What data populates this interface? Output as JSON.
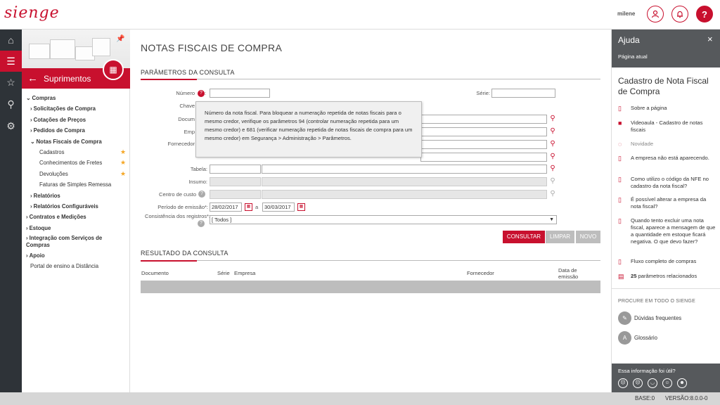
{
  "app": {
    "logo": "sienge",
    "username": "milene"
  },
  "topbar": {
    "user_icon": "user-icon",
    "bell_icon": "bell-icon",
    "help_label": "?"
  },
  "rail": [
    "home-icon",
    "menu-icon",
    "star-icon",
    "search-icon",
    "settings-icon"
  ],
  "sidebar": {
    "title": "Suprimentos",
    "menu": [
      {
        "label": "Compras",
        "level": "l1",
        "prefix": "⌄"
      },
      {
        "label": "Solicitações de Compra",
        "level": "l2",
        "prefix": "›"
      },
      {
        "label": "Cotações de Preços",
        "level": "l2",
        "prefix": "›"
      },
      {
        "label": "Pedidos de Compra",
        "level": "l2",
        "prefix": "›"
      },
      {
        "label": "Notas Fiscais de Compra",
        "level": "l2",
        "prefix": "⌄"
      },
      {
        "label": "Cadastros",
        "level": "l3",
        "star": true
      },
      {
        "label": "Conhecimentos de Fretes",
        "level": "l3",
        "star": true
      },
      {
        "label": "Devoluções",
        "level": "l3",
        "star": true
      },
      {
        "label": "Faturas de Simples Remessa",
        "level": "l3"
      },
      {
        "label": "Relatórios",
        "level": "l2",
        "prefix": "›"
      },
      {
        "label": "Relatórios Configuráveis",
        "level": "l2",
        "prefix": "›"
      },
      {
        "label": "Contratos e Medições",
        "level": "l1",
        "prefix": "›"
      },
      {
        "label": "Estoque",
        "level": "l1",
        "prefix": "›"
      },
      {
        "label": "Integração com Serviços de Compras",
        "level": "l1",
        "prefix": "›",
        "two": true
      },
      {
        "label": "Apoio",
        "level": "l1",
        "prefix": "›"
      },
      {
        "label": "Portal de ensino a Distância",
        "level": "plain"
      }
    ]
  },
  "main": {
    "page_title": "NOTAS FISCAIS DE COMPRA",
    "params_title": "PARÂMETROS DA CONSULTA",
    "results_title": "RESULTADO DA CONSULTA",
    "labels": {
      "numero": "Número",
      "serie": "Série:",
      "chave": "Chave",
      "documento": "Docum",
      "empresa": "Emp",
      "fornecedor": "Fornecedor",
      "tabela": "Tabela:",
      "insumo": "Insumo:",
      "centro_custo": "Centro de custo",
      "periodo": "Período de emissão*:",
      "periodo_sep": "a",
      "consistencia": "Consistência dos registros*:"
    },
    "colon": ":",
    "date_from": "28/02/2017",
    "date_to": "30/03/2017",
    "consistencia_value": "[ Todos ]",
    "tooltip": "Número da nota fiscal. Para bloquear a numeração repetida de notas fiscais para o mesmo credor, verifique os parâmetros 94 (controlar numeração repetida para um mesmo credor) e 681 (verificar numeração repetida de notas fiscais de compra para um mesmo credor) em Segurança > Administração > Parâmetros.",
    "buttons": {
      "consultar": "CONSULTAR",
      "limpar": "LIMPAR",
      "novo": "NOVO"
    },
    "columns": {
      "documento": "Documento",
      "serie": "Série",
      "empresa": "Empresa",
      "fornecedor": "Fornecedor",
      "data": "Data de emissão"
    }
  },
  "help": {
    "title": "Ajuda",
    "close": "×",
    "subtitle": "Página atual",
    "heading": "Cadastro de Nota Fiscal de Compra",
    "items": [
      {
        "label": "Sobre a página",
        "icon": "document-icon"
      },
      {
        "label": "Videoaula - Cadastro de notas fiscais",
        "icon": "video-icon"
      },
      {
        "label": "Novidade",
        "icon": "novelty-icon",
        "muted": true
      },
      {
        "label": "A empresa não está aparecendo.",
        "icon": "document-icon"
      },
      {
        "label": "Como utilizo o código da NFE no cadastro da nota fiscal?",
        "icon": "document-icon"
      },
      {
        "label": "É possível alterar a empresa da nota fiscal?",
        "icon": "document-icon"
      },
      {
        "label": "Quando tento excluir uma nota fiscal, aparece a mensagem de que a quantidade em estoque ficará negativa. O que devo fazer?",
        "icon": "document-icon"
      },
      {
        "label": "Fluxo completo de compras",
        "icon": "document-icon"
      }
    ],
    "params_count": "25",
    "params_label": "parâmetros relacionados",
    "search_all": "PROCURE EM TODO O SIENGE",
    "faq": "Dúvidas frequentes",
    "glossary": "Glossário",
    "feedback_q": "Essa informação foi útil?"
  },
  "status": {
    "base": "BASE:0",
    "version": "VERSÃO:8.0.0-0"
  },
  "colors": {
    "brand_red": "#c8102e",
    "dark_rail": "#2e3338",
    "panel_gray": "#56595c"
  }
}
